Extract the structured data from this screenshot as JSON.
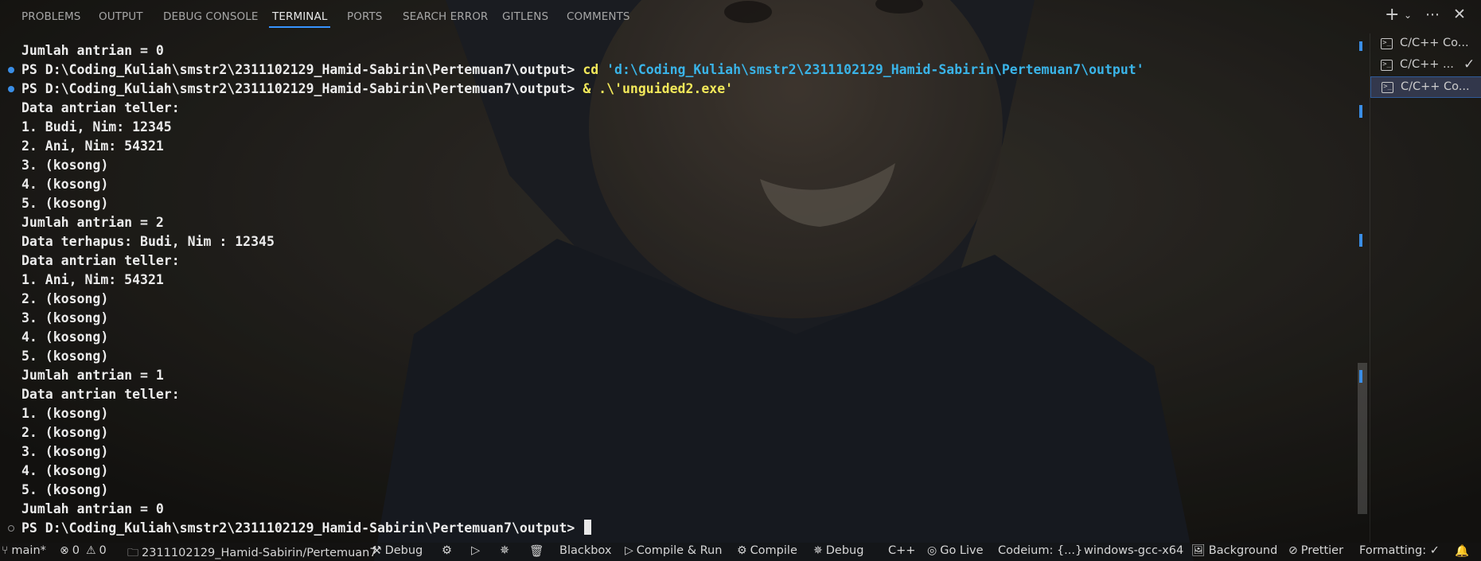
{
  "panel": {
    "tabs": [
      {
        "label": "PROBLEMS"
      },
      {
        "label": "OUTPUT"
      },
      {
        "label": "DEBUG CONSOLE"
      },
      {
        "label": "TERMINAL",
        "active": true
      },
      {
        "label": "PORTS"
      },
      {
        "label": "SEARCH ERROR"
      },
      {
        "label": "GITLENS"
      },
      {
        "label": "COMMENTS"
      }
    ],
    "icons": [
      "plus-icon",
      "chevron-down-icon",
      "ellipsis-icon",
      "close-icon"
    ]
  },
  "terminal": {
    "lines": [
      {
        "text": "Jumlah antrian = 0"
      },
      {
        "prompt": "PS D:\\Coding_Kuliah\\smstr2\\2311102129_Hamid-Sabirin\\Pertemuan7\\output> ",
        "cmd": "cd",
        "arg": " 'd:\\Coding_Kuliah\\smstr2\\2311102129_Hamid-Sabirin\\Pertemuan7\\output'",
        "marker": "blue"
      },
      {
        "prompt": "PS D:\\Coding_Kuliah\\smstr2\\2311102129_Hamid-Sabirin\\Pertemuan7\\output> ",
        "cmd": "& .\\",
        "arg": "'unguided2.exe'",
        "marker": "blue"
      },
      {
        "text": "Data antrian teller:"
      },
      {
        "text": "1. Budi, Nim: 12345"
      },
      {
        "text": "2. Ani, Nim: 54321"
      },
      {
        "text": "3. (kosong)"
      },
      {
        "text": "4. (kosong)"
      },
      {
        "text": "5. (kosong)"
      },
      {
        "text": "Jumlah antrian = 2"
      },
      {
        "text": "Data terhapus: Budi, Nim : 12345"
      },
      {
        "text": "Data antrian teller:"
      },
      {
        "text": "1. Ani, Nim: 54321"
      },
      {
        "text": "2. (kosong)"
      },
      {
        "text": "3. (kosong)"
      },
      {
        "text": "4. (kosong)"
      },
      {
        "text": "5. (kosong)"
      },
      {
        "text": "Jumlah antrian = 1"
      },
      {
        "text": "Data antrian teller:"
      },
      {
        "text": "1. (kosong)"
      },
      {
        "text": "2. (kosong)"
      },
      {
        "text": "3. (kosong)"
      },
      {
        "text": "4. (kosong)"
      },
      {
        "text": "5. (kosong)"
      },
      {
        "text": "Jumlah antrian = 0"
      },
      {
        "prompt": "PS D:\\Coding_Kuliah\\smstr2\\2311102129_Hamid-Sabirin\\Pertemuan7\\output> ",
        "marker": "hollow",
        "cursor": true
      }
    ]
  },
  "terminal_list": [
    {
      "label": "C/C++ Co...",
      "icon": "terminal-icon"
    },
    {
      "label": "C/C++ ...",
      "icon": "terminal-icon",
      "check": "✓"
    },
    {
      "label": "C/C++ Co...",
      "icon": "terminal-icon",
      "selected": true
    }
  ],
  "status_bar": {
    "branch": "main*",
    "errors": "0",
    "warnings": "0",
    "folder": "2311102129_Hamid-Sabirin/Pertemuan7",
    "debug": "Debug",
    "blackbox": "Blackbox",
    "compile_run": "Compile & Run",
    "compile": "Compile",
    "debug2": "Debug",
    "language": "C++",
    "go_live": "Go Live",
    "codeium": "Codeium: {...}",
    "compiler": "windows-gcc-x64",
    "background": "Background",
    "prettier": "Prettier",
    "formatting": "Formatting: ✓"
  },
  "colors": {
    "accent": "#3794ff",
    "command": "#f2e85a",
    "string": "#3ab4e8",
    "marker": "#3a8ee6"
  }
}
